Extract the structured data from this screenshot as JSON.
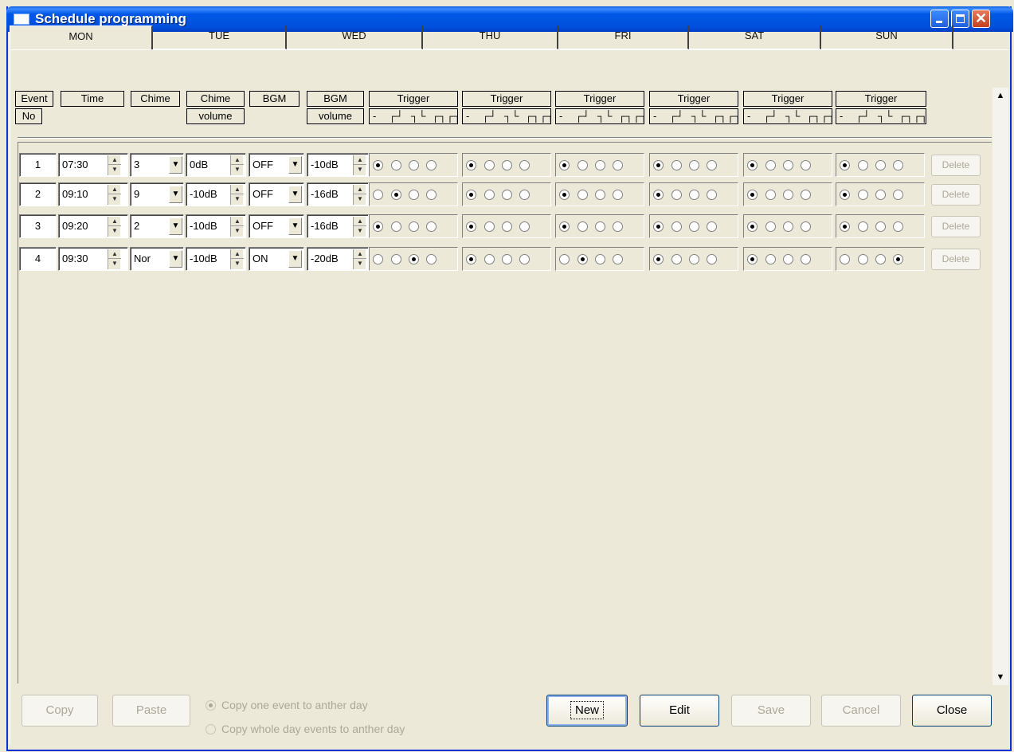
{
  "window": {
    "title": "Schedule programming"
  },
  "tabs": [
    "MON",
    "TUE",
    "WED",
    "THU",
    "FRI",
    "SAT",
    "SUN"
  ],
  "headers": {
    "event": "Event",
    "event_no": "No",
    "time": "Time",
    "chime": "Chime",
    "chime_vol": "Chime",
    "chime_vol2": "volume",
    "bgm": "BGM",
    "bgm_vol": "BGM",
    "bgm_vol2": "volume",
    "trigger": "Trigger",
    "trigger_symbols": [
      "-",
      "┌┘",
      "┐└",
      "┌┐┌┐"
    ]
  },
  "events": [
    {
      "no": "1",
      "time": "07:30",
      "chime": "3",
      "chime_volume": "0dB",
      "bgm": "OFF",
      "bgm_volume": "-10dB",
      "triggers": [
        0,
        0,
        0,
        0,
        0,
        0
      ],
      "delete": "Delete"
    },
    {
      "no": "2",
      "time": "09:10",
      "chime": "9",
      "chime_volume": "-10dB",
      "bgm": "OFF",
      "bgm_volume": "-16dB",
      "triggers": [
        1,
        0,
        0,
        0,
        0,
        0
      ],
      "delete": "Delete"
    },
    {
      "no": "3",
      "time": "09:20",
      "chime": "2",
      "chime_volume": "-10dB",
      "bgm": "OFF",
      "bgm_volume": "-16dB",
      "triggers": [
        0,
        0,
        0,
        0,
        0,
        0
      ],
      "delete": "Delete"
    },
    {
      "no": "4",
      "time": "09:30",
      "chime": "Nor",
      "chime_volume": "-10dB",
      "bgm": "ON",
      "bgm_volume": "-20dB",
      "triggers": [
        2,
        0,
        1,
        0,
        0,
        3
      ],
      "delete": "Delete"
    }
  ],
  "footer": {
    "copy": "Copy",
    "paste": "Paste",
    "opt_one": "Copy one event to anther day",
    "opt_whole": "Copy whole day events to anther day",
    "new": "New",
    "edit": "Edit",
    "save": "Save",
    "cancel": "Cancel",
    "close": "Close"
  }
}
